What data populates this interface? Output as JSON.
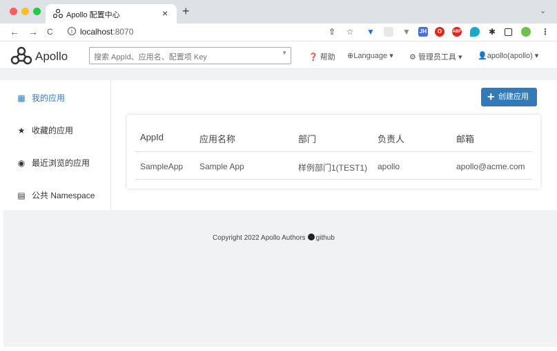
{
  "browser": {
    "tab_title": "Apollo 配置中心",
    "tab_close": "×",
    "new_tab": "+",
    "tab_menu": "⌄",
    "url_host": "localhost",
    "url_port": ":8070",
    "nav": {
      "back": "←",
      "forward": "→",
      "reload": "C"
    },
    "extensions": [
      "share-icon",
      "star-icon",
      "v-ext-icon",
      "ext-icon",
      "v-ext-icon",
      "3h-ext-icon",
      "opera-icon",
      "abp-icon",
      "ext-icon",
      "puzzle-icon",
      "sidebar-icon",
      "frog-ext-icon",
      "menu-icon"
    ]
  },
  "header": {
    "logo_text": "Apollo",
    "search_placeholder": "搜索 AppId、应用名、配置项 Key",
    "help": "帮助",
    "language": "Language",
    "admin_tools": "管理员工具",
    "user": "apollo(apollo)"
  },
  "sidebar": {
    "items": [
      {
        "label": "我的应用",
        "icon": "grid-icon"
      },
      {
        "label": "收藏的应用",
        "icon": "star-icon"
      },
      {
        "label": "最近浏览的应用",
        "icon": "eye-icon"
      },
      {
        "label": "公共 Namespace",
        "icon": "book-icon"
      }
    ]
  },
  "main": {
    "create_button": "创建应用",
    "table": {
      "headers": [
        "AppId",
        "应用名称",
        "部门",
        "负责人",
        "邮箱"
      ],
      "rows": [
        [
          "SampleApp",
          "Sample App",
          "样例部门1(TEST1)",
          "apollo",
          "apollo@acme.com"
        ]
      ]
    }
  },
  "footer": {
    "copyright": "Copyright 2022 Apollo Authors",
    "github": "github"
  },
  "colors": {
    "accent": "#337ab7",
    "band": "#f1f2f4",
    "tabbar": "#dee1e6"
  }
}
